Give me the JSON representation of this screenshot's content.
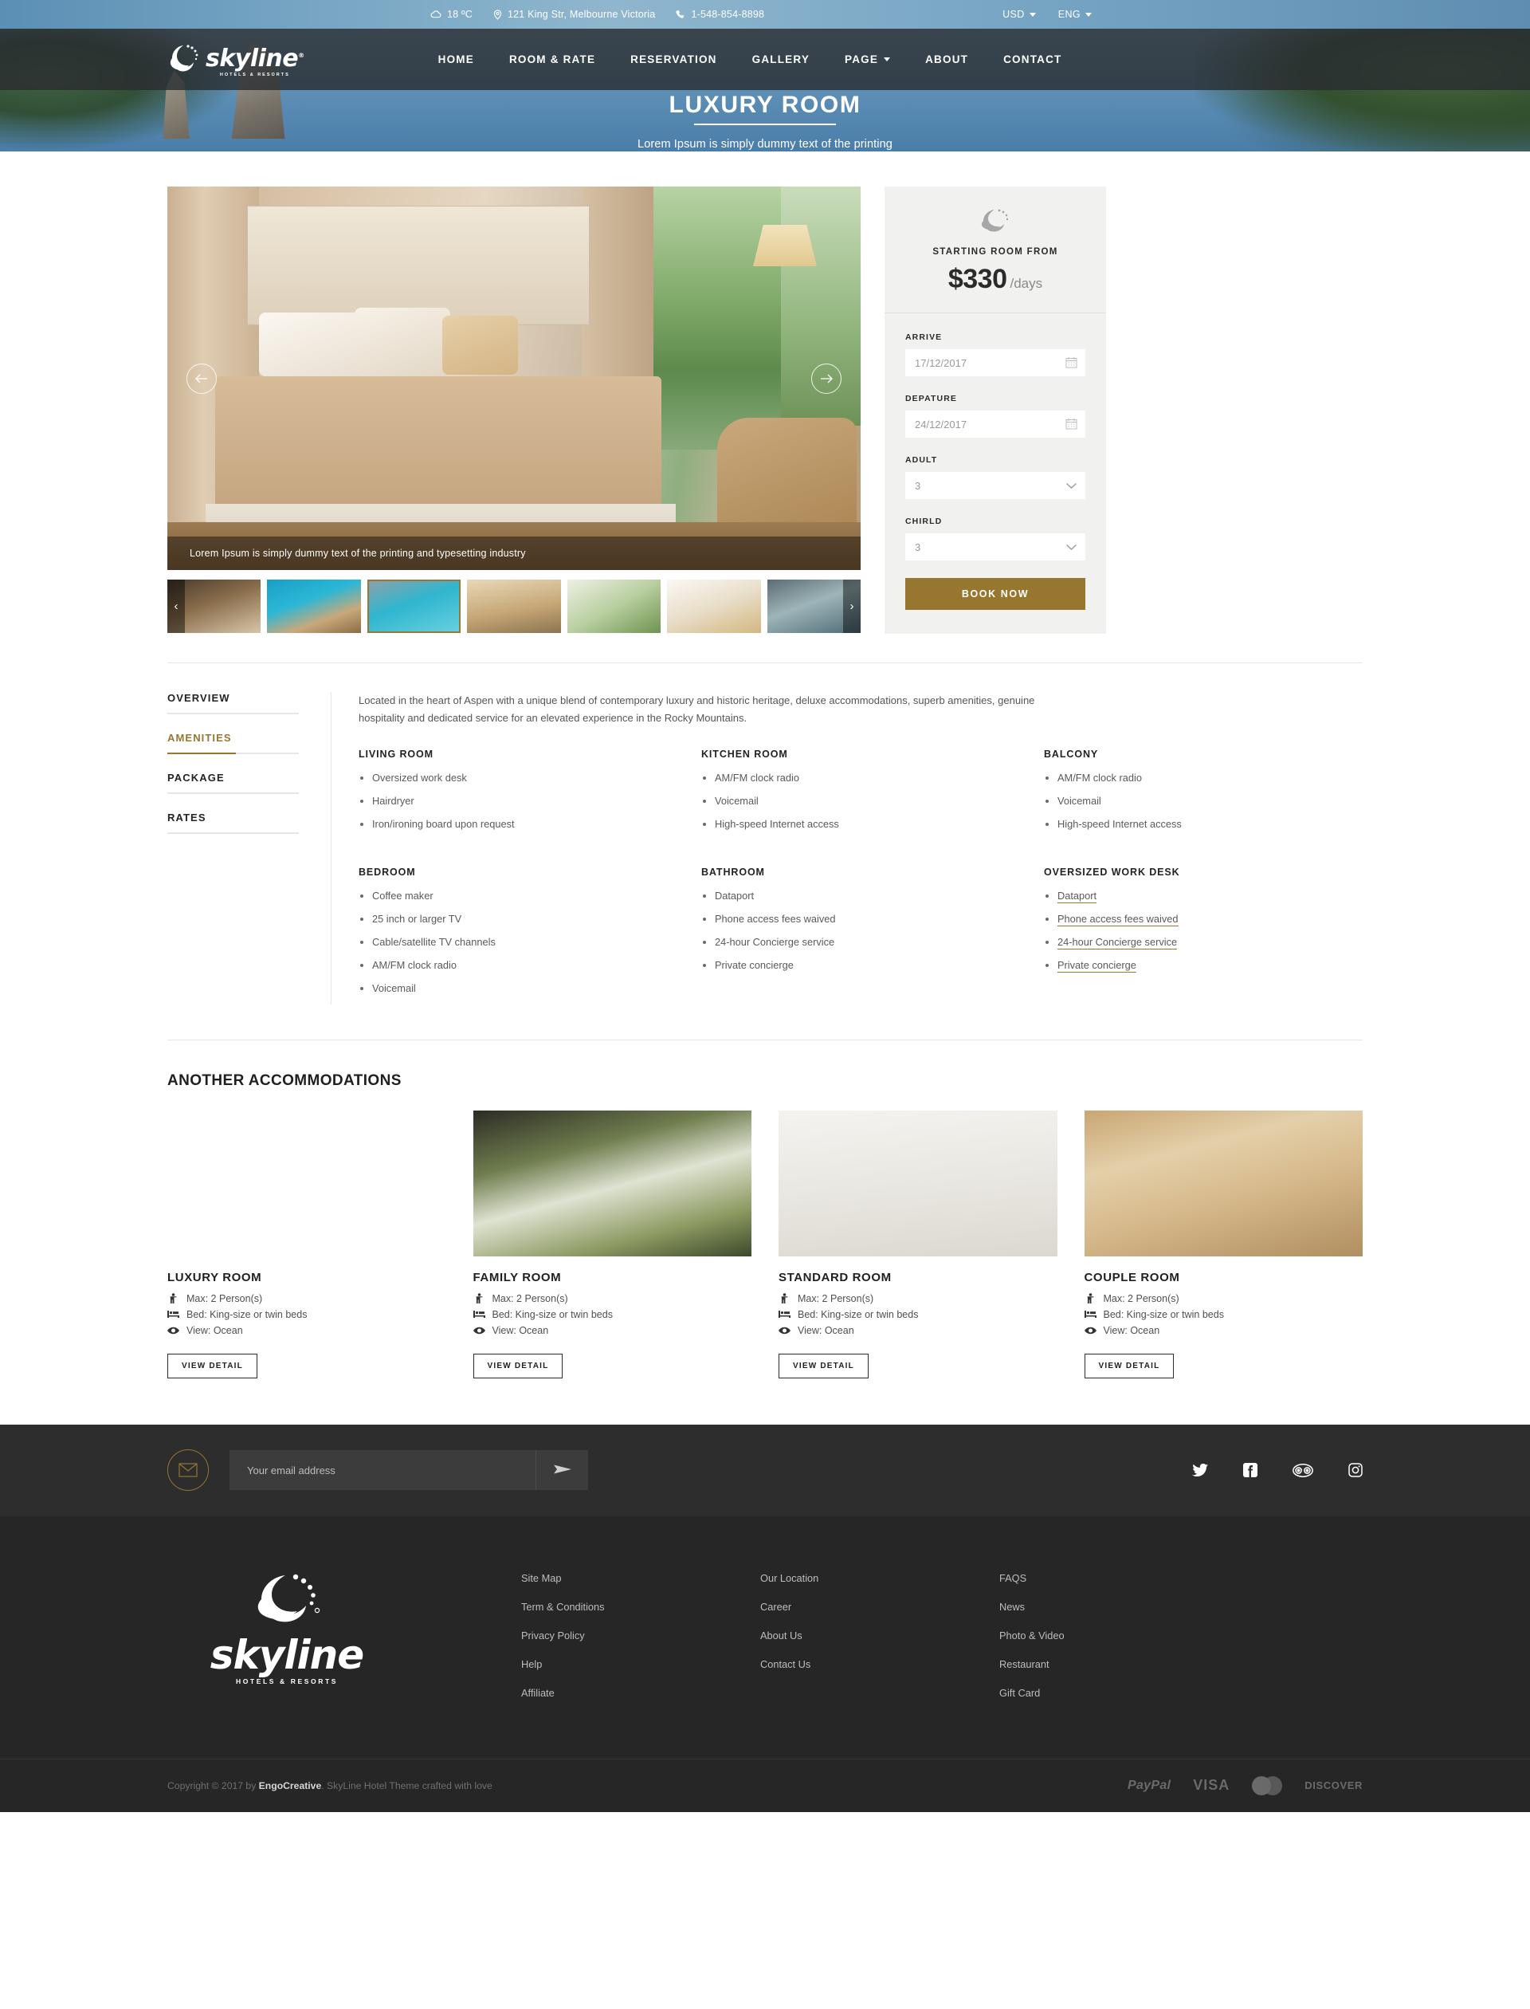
{
  "topbar": {
    "weather": "18 ºC",
    "address": "121 King Str, Melbourne Victoria",
    "phone": "1-548-854-8898",
    "currency": "USD",
    "language": "ENG"
  },
  "brand": {
    "name": "skyline",
    "tagline": "HOTELS & RESORTS",
    "registered": "®"
  },
  "nav": [
    {
      "label": "HOME",
      "has_caret": false
    },
    {
      "label": "ROOM & RATE",
      "has_caret": false
    },
    {
      "label": "RESERVATION",
      "has_caret": false
    },
    {
      "label": "GALLERY",
      "has_caret": false
    },
    {
      "label": "PAGE",
      "has_caret": true
    },
    {
      "label": "ABOUT",
      "has_caret": false
    },
    {
      "label": "CONTACT",
      "has_caret": false
    }
  ],
  "hero": {
    "title": "LUXURY ROOM",
    "subtitle": "Lorem Ipsum is simply dummy text of the printing"
  },
  "gallery": {
    "caption": "Lorem Ipsum is simply dummy text of the printing and typesetting industry",
    "prev": "‹",
    "next": "›",
    "thumbs": [
      {
        "name": "thumb-dining"
      },
      {
        "name": "thumb-climbing"
      },
      {
        "name": "thumb-pool"
      },
      {
        "name": "thumb-terrace"
      },
      {
        "name": "thumb-flowers"
      },
      {
        "name": "thumb-breakfast"
      },
      {
        "name": "thumb-lounge"
      }
    ]
  },
  "booking": {
    "starting_label": "STARTING ROOM FROM",
    "price": "$330",
    "price_unit": "/days",
    "arrive_label": "ARRIVE",
    "arrive_value": "17/12/2017",
    "departure_label": "DEPATURE",
    "departure_value": "24/12/2017",
    "adult_label": "ADULT",
    "adult_value": "3",
    "child_label": "CHIRLD",
    "child_value": "3",
    "book_label": "BOOK NOW",
    "accent_color": "#97762f"
  },
  "tabs": [
    {
      "label": "OVERVIEW",
      "active": false
    },
    {
      "label": "AMENITIES",
      "active": true
    },
    {
      "label": "PACKAGE",
      "active": false
    },
    {
      "label": "RATES",
      "active": false
    }
  ],
  "panel": {
    "intro": "Located in the heart of Aspen with a unique blend of contemporary luxury and historic heritage, deluxe accommodations, superb amenities, genuine hospitality and dedicated service for an elevated experience in the Rocky Mountains.",
    "groups": [
      {
        "title": "LIVING ROOM",
        "link": false,
        "items": [
          "Oversized work desk",
          "Hairdryer",
          "Iron/ironing board upon request"
        ]
      },
      {
        "title": "KITCHEN ROOM",
        "link": false,
        "items": [
          "AM/FM clock radio",
          "Voicemail",
          "High-speed Internet access"
        ]
      },
      {
        "title": "BALCONY",
        "link": false,
        "items": [
          "AM/FM clock radio",
          "Voicemail",
          "High-speed Internet access"
        ]
      },
      {
        "title": "BEDROOM",
        "link": false,
        "items": [
          "Coffee maker",
          "25 inch or larger TV",
          "Cable/satellite TV channels",
          "AM/FM clock radio",
          "Voicemail"
        ]
      },
      {
        "title": "BATHROOM",
        "link": false,
        "items": [
          "Dataport",
          "Phone access fees waived",
          "24-hour Concierge service",
          "Private concierge"
        ]
      },
      {
        "title": "OVERSIZED WORK DESK",
        "link": true,
        "items": [
          "Dataport",
          "Phone access fees waived",
          "24-hour Concierge service",
          "Private concierge"
        ]
      }
    ]
  },
  "another": {
    "title": "ANOTHER ACCOMMODATIONS",
    "button_label": "VIEW DETAIL",
    "rooms": [
      {
        "name": "LUXURY ROOM",
        "max": "Max: 2 Person(s)",
        "bed": "Bed: King-size or twin beds",
        "view": "View: Ocean"
      },
      {
        "name": "FAMILY ROOM",
        "max": "Max: 2 Person(s)",
        "bed": "Bed: King-size or twin beds",
        "view": "View: Ocean"
      },
      {
        "name": "STANDARD ROOM",
        "max": "Max: 2 Person(s)",
        "bed": "Bed: King-size or twin beds",
        "view": "View: Ocean"
      },
      {
        "name": "COUPLE ROOM",
        "max": "Max: 2 Person(s)",
        "bed": "Bed: King-size or twin beds",
        "view": "View: Ocean"
      }
    ]
  },
  "newsletter": {
    "placeholder": "Your email address",
    "value": "",
    "socials": [
      "twitter-icon",
      "facebook-icon",
      "tripadvisor-icon",
      "instagram-icon"
    ]
  },
  "footer": {
    "columns": [
      [
        "Site Map",
        "Term & Conditions",
        "Privacy Policy",
        "Help",
        "Affiliate"
      ],
      [
        "Our Location",
        "Career",
        "About Us",
        "Contact Us"
      ],
      [
        "FAQS",
        "News",
        "Photo & Video",
        "Restaurant",
        "Gift Card"
      ]
    ],
    "copyright_pre": "Copyright © 2017 by ",
    "copyright_brand": "EngoCreative",
    "copyright_post": ". SkyLine Hotel Theme crafted with love",
    "payments": [
      "PayPal",
      "VISA",
      "MasterCard",
      "DISCOVER"
    ]
  }
}
